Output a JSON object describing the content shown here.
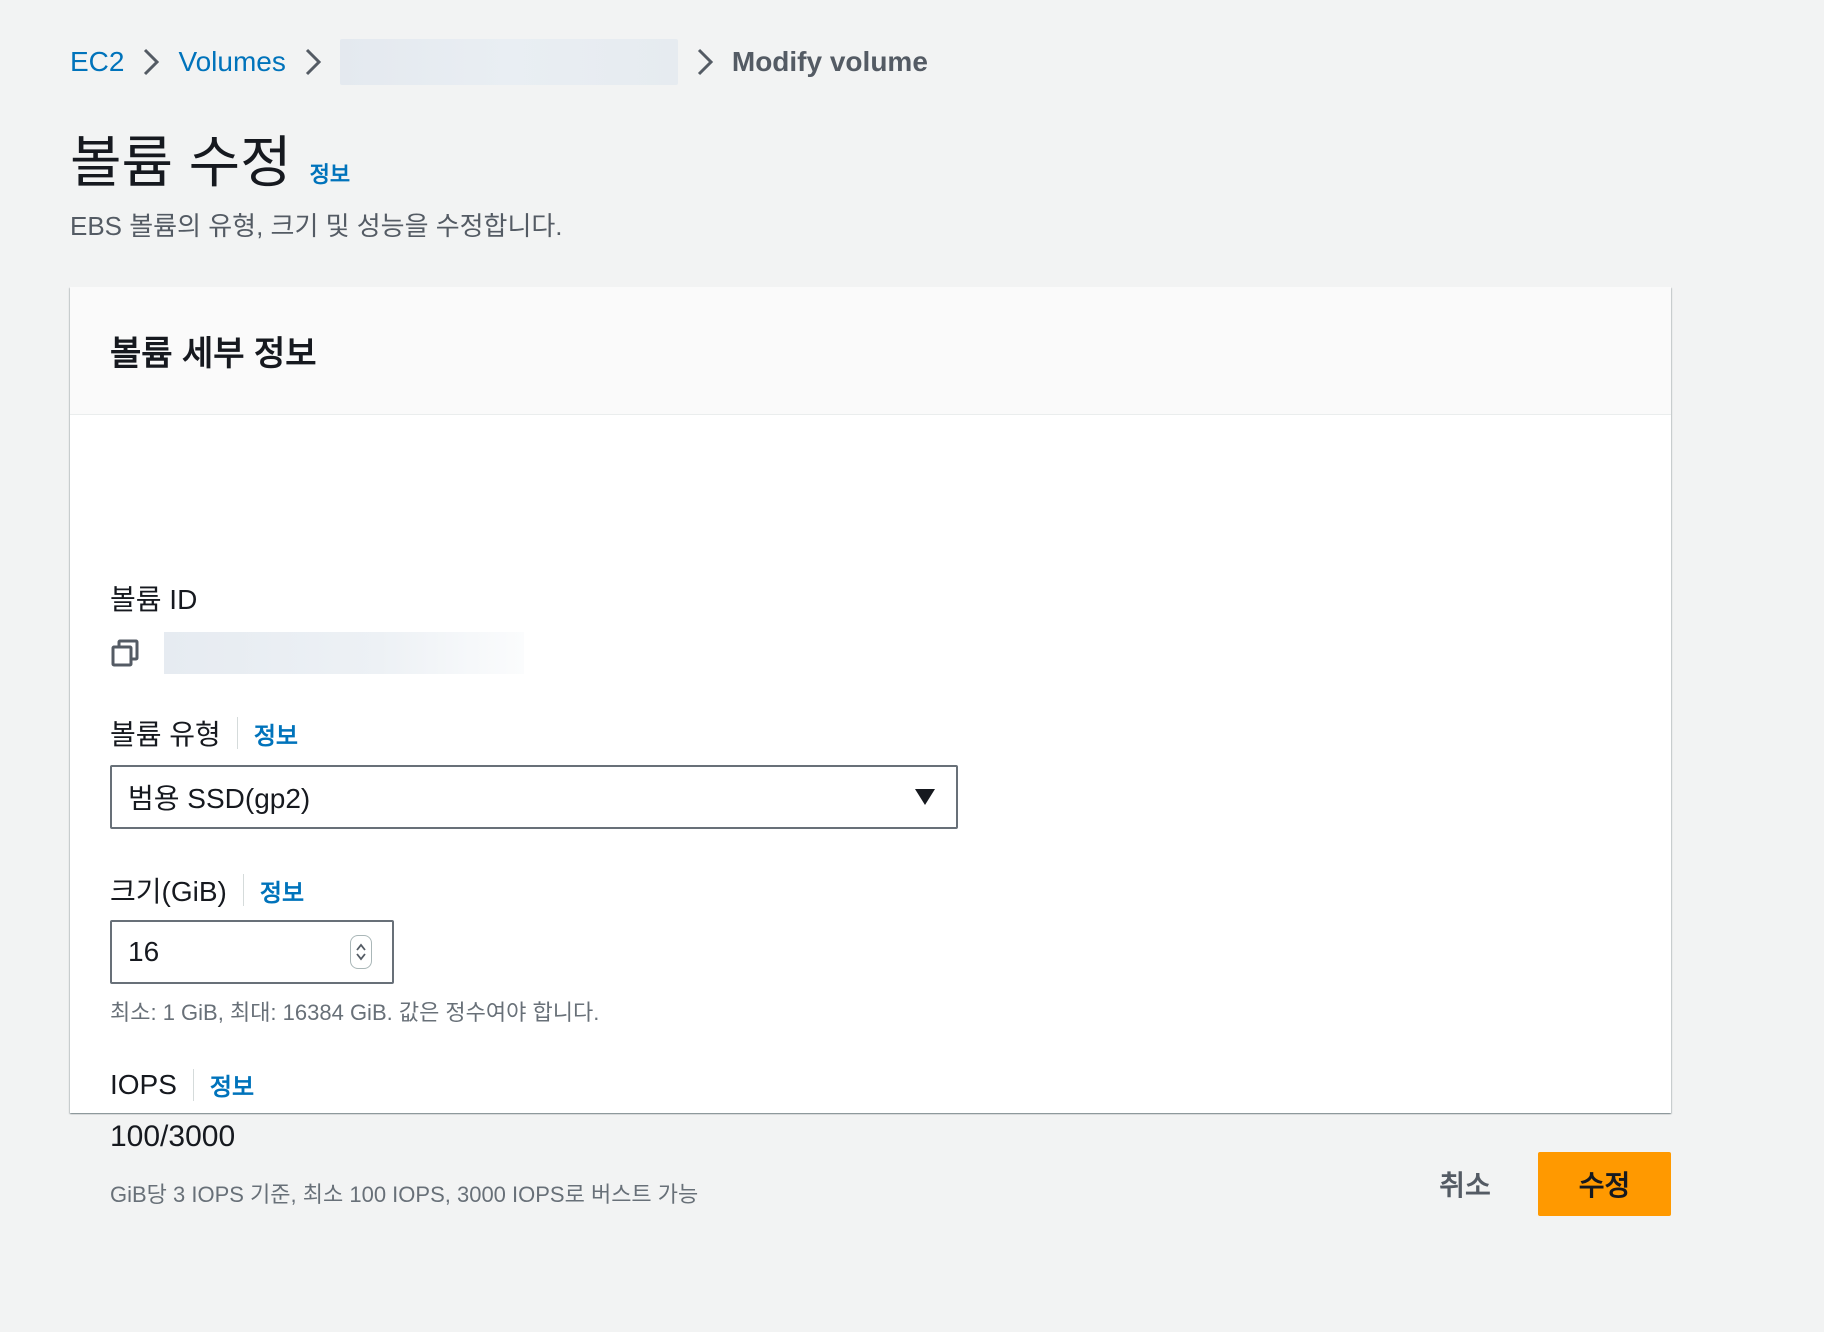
{
  "breadcrumb": {
    "items": [
      "EC2",
      "Volumes"
    ],
    "current": "Modify volume"
  },
  "header": {
    "title": "볼륨 수정",
    "info": "정보",
    "description": "EBS 볼륨의 유형, 크기 및 성능을 수정합니다."
  },
  "panel": {
    "title": "볼륨 세부 정보",
    "volume_id": {
      "label": "볼륨 ID"
    },
    "volume_type": {
      "label": "볼륨 유형",
      "info": "정보",
      "selected": "범용 SSD(gp2)"
    },
    "size": {
      "label": "크기(GiB)",
      "info": "정보",
      "value": "16",
      "hint": "최소: 1 GiB, 최대: 16384 GiB. 값은 정수여야 합니다."
    },
    "iops": {
      "label": "IOPS",
      "info": "정보",
      "value": "100/3000",
      "hint": "GiB당 3 IOPS 기준, 최소 100 IOPS, 3000 IOPS로 버스트 가능"
    }
  },
  "actions": {
    "cancel": "취소",
    "submit": "수정"
  },
  "colors": {
    "link": "#0073bb",
    "primary": "#ff9900",
    "background": "#f2f3f3"
  }
}
